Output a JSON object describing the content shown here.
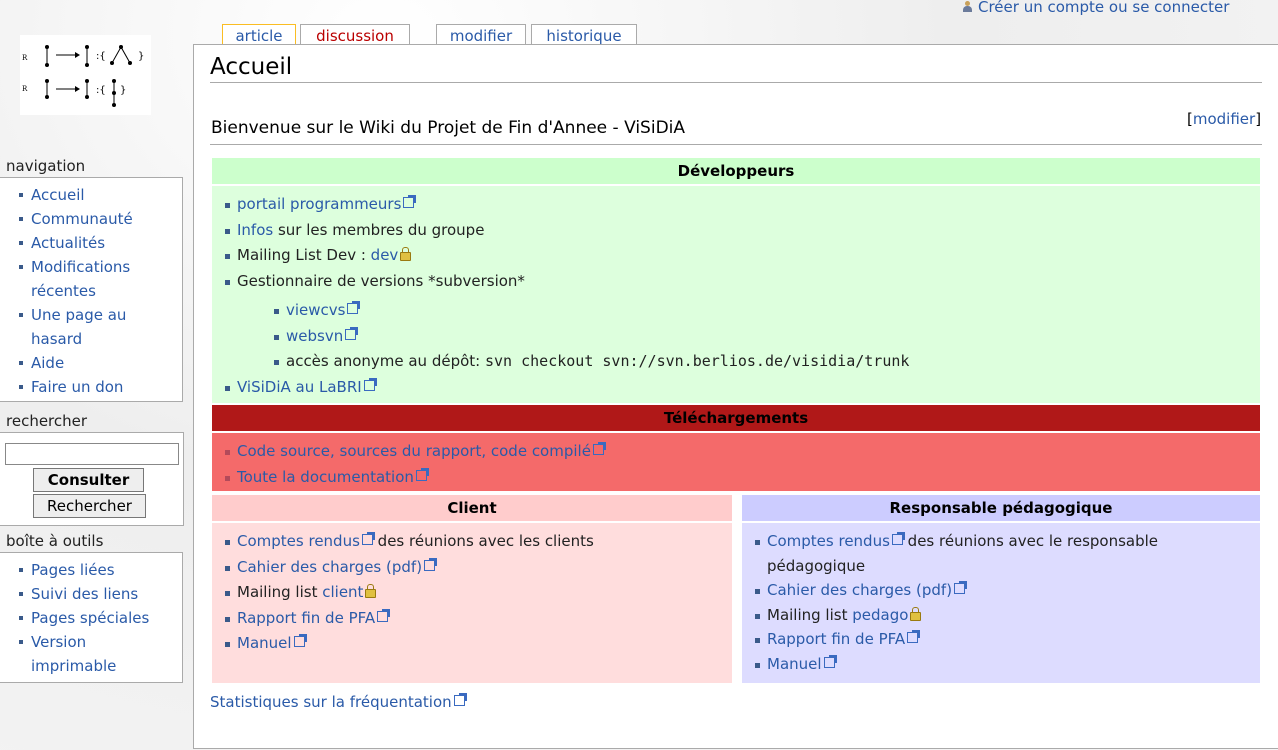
{
  "user": {
    "link_label": "Créer un compte ou se connecter"
  },
  "tabs": [
    {
      "label": "article",
      "selected": true
    },
    {
      "label": "discussion",
      "selected": false
    },
    {
      "label": "modifier",
      "selected": false
    },
    {
      "label": "historique",
      "selected": false
    }
  ],
  "page": {
    "title": "Accueil",
    "section_heading": "Bienvenue sur le Wiki du Projet de Fin d'Annee - ViSiDiA",
    "section_edit": "modifier"
  },
  "developers": {
    "heading": "Développeurs",
    "items": {
      "portail": "portail programmeurs",
      "infos_link": "Infos",
      "infos_text": " sur les membres du groupe",
      "mailing_text": "Mailing List Dev : ",
      "mailing_link": "dev",
      "versions_text": "Gestionnaire de versions *subversion*",
      "viewcvs": "viewcvs",
      "websvn": "websvn",
      "anon_text": "accès anonyme au dépôt: ",
      "anon_cmd": "svn checkout svn://svn.berlios.de/visidia/trunk",
      "labri": "ViSiDiA au LaBRI"
    }
  },
  "downloads": {
    "heading": "Téléchargements",
    "source": "Code source, sources du rapport, code compilé",
    "docs": "Toute la documentation"
  },
  "client": {
    "heading": "Client",
    "comptes_link": "Comptes rendus",
    "comptes_text": " des réunions avec les clients",
    "cahier": "Cahier des charges (pdf)",
    "mailing_text": "Mailing list ",
    "mailing_link": "client",
    "rapport": "Rapport fin de PFA",
    "manuel": "Manuel"
  },
  "pedago": {
    "heading": "Responsable pédagogique",
    "comptes_link": "Comptes rendus",
    "comptes_text": " des réunions avec le responsable pédagogique",
    "cahier": "Cahier des charges (pdf)",
    "mailing_text": "Mailing list ",
    "mailing_link": "pedago",
    "rapport": "Rapport fin de PFA",
    "manuel": "Manuel"
  },
  "stats_link": "Statistiques sur la fréquentation",
  "sidebar": {
    "navigation_title": "navigation",
    "navigation_items": [
      "Accueil",
      "Communauté",
      "Actualités",
      "Modifications récentes",
      "Une page au hasard",
      "Aide",
      "Faire un don"
    ],
    "search_title": "rechercher",
    "search_value": "",
    "go_button": "Consulter",
    "search_button": "Rechercher",
    "tools_title": "boîte à outils",
    "tools_items": [
      "Pages liées",
      "Suivi des liens",
      "Pages spéciales",
      "Version imprimable"
    ]
  }
}
